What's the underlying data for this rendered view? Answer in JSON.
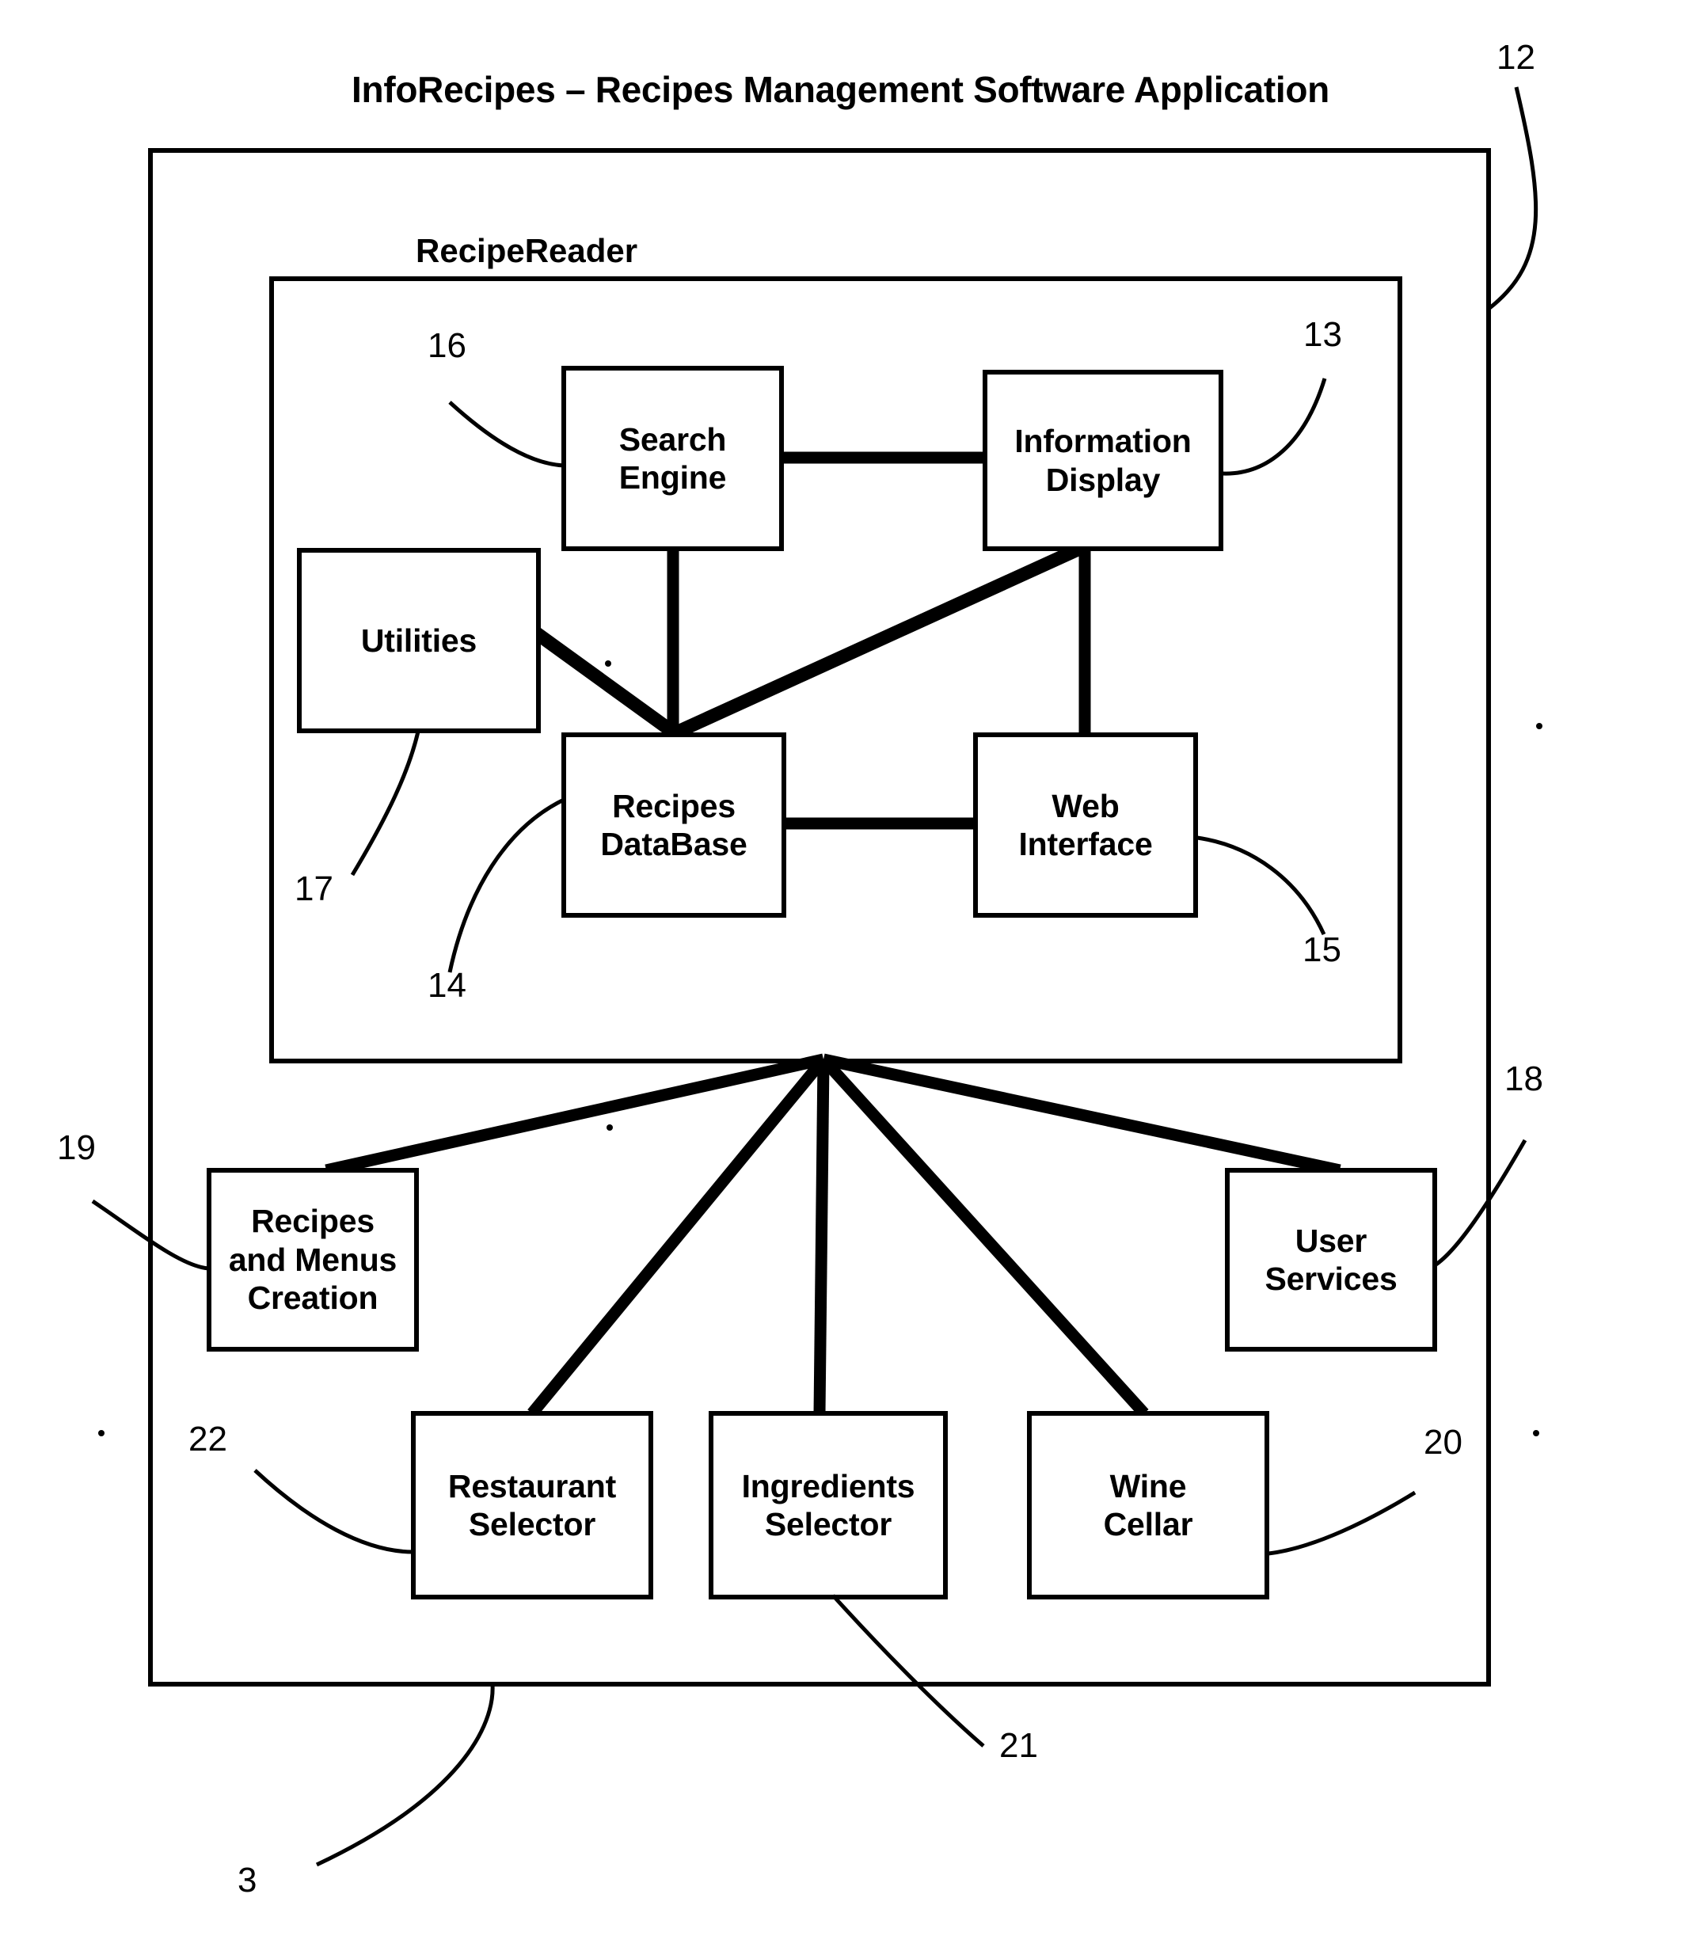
{
  "figure": {
    "title": "InfoRecipes – Recipes Management Software Application",
    "outer_container_label": "",
    "inner_group_label": "RecipeReader"
  },
  "nodes": {
    "search_engine": "Search\nEngine",
    "information_display": "Information\nDisplay",
    "utilities": "Utilities",
    "recipes_database": "Recipes\nDataBase",
    "web_interface": "Web\nInterface",
    "recipes_and_menus_creation": "Recipes\nand Menus\nCreation",
    "user_services": "User\nServices",
    "restaurant_selector": "Restaurant\nSelector",
    "ingredients_selector": "Ingredients\nSelector",
    "wine_cellar": "Wine\nCellar"
  },
  "reference_numerals": {
    "outer_system": "12",
    "information_display": "13",
    "recipes_database": "14",
    "web_interface": "15",
    "search_engine": "16",
    "utilities": "17",
    "user_services": "18",
    "recipes_and_menus_creation": "19",
    "wine_cellar": "20",
    "ingredients_selector": "21",
    "restaurant_selector": "22",
    "figure_number": "3"
  },
  "style": {
    "ink": "#000000",
    "paper": "#ffffff"
  },
  "chart_data": {
    "type": "diagram",
    "title": "InfoRecipes – Recipes Management Software Application",
    "containers": [
      {
        "id": "12",
        "label": "",
        "children": [
          "RecipeReader",
          "Recipes and Menus Creation",
          "Restaurant Selector",
          "Ingredients Selector",
          "Wine Cellar",
          "User Services"
        ]
      },
      {
        "id": "RecipeReader",
        "label": "RecipeReader",
        "children": [
          "Search Engine",
          "Information Display",
          "Utilities",
          "Recipes DataBase",
          "Web Interface"
        ]
      }
    ],
    "blocks": [
      {
        "id": "16",
        "label": "Search Engine"
      },
      {
        "id": "13",
        "label": "Information Display"
      },
      {
        "id": "17",
        "label": "Utilities"
      },
      {
        "id": "14",
        "label": "Recipes DataBase"
      },
      {
        "id": "15",
        "label": "Web Interface"
      },
      {
        "id": "19",
        "label": "Recipes and Menus Creation"
      },
      {
        "id": "18",
        "label": "User Services"
      },
      {
        "id": "22",
        "label": "Restaurant Selector"
      },
      {
        "id": "21",
        "label": "Ingredients Selector"
      },
      {
        "id": "20",
        "label": "Wine Cellar"
      }
    ],
    "edges": [
      {
        "from": "Search Engine",
        "to": "Information Display"
      },
      {
        "from": "Search Engine",
        "to": "Recipes DataBase"
      },
      {
        "from": "Utilities",
        "to": "Recipes DataBase"
      },
      {
        "from": "Information Display",
        "to": "Recipes DataBase"
      },
      {
        "from": "Information Display",
        "to": "Web Interface"
      },
      {
        "from": "Recipes DataBase",
        "to": "Web Interface"
      },
      {
        "from": "RecipeReader",
        "to": "Recipes and Menus Creation"
      },
      {
        "from": "RecipeReader",
        "to": "Restaurant Selector"
      },
      {
        "from": "RecipeReader",
        "to": "Ingredients Selector"
      },
      {
        "from": "RecipeReader",
        "to": "Wine Cellar"
      },
      {
        "from": "RecipeReader",
        "to": "User Services"
      }
    ]
  }
}
